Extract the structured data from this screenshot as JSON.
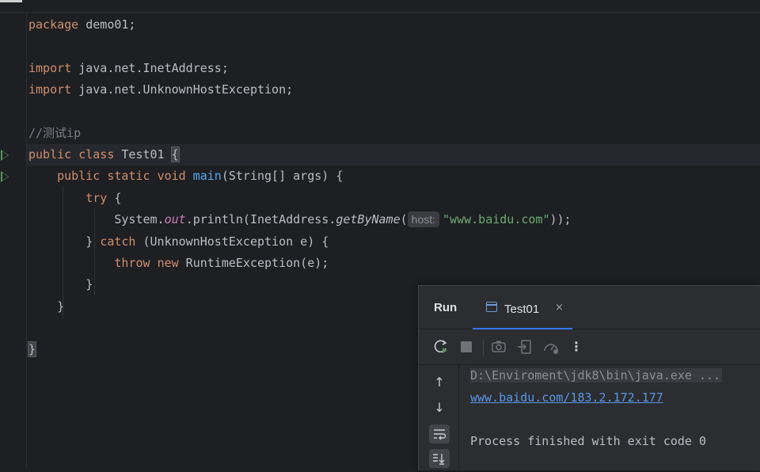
{
  "editor": {
    "package_kw": "package",
    "package_name": " demo01;",
    "import_kw": "import",
    "import1": " java.net.InetAddress;",
    "import2": " java.net.UnknownHostException;",
    "comment": "//测试ip",
    "class_line": {
      "public": "public",
      "class": "class",
      "name": "Test01 ",
      "brace": "{"
    },
    "main_line": {
      "public": "public",
      "static": "static",
      "void": "void",
      "name": "main",
      "rest": "(String[] args) {"
    },
    "try_line": {
      "try": "try",
      "rest": " {"
    },
    "println_line": {
      "pre": "System.",
      "out": "out",
      "mid": ".println(InetAddress.",
      "method": "getByName",
      "open": "(",
      "hint": "host:",
      "str": "\"www.baidu.com\"",
      "close": "));"
    },
    "catch_line": {
      "pre": "} ",
      "catch": "catch",
      "rest": " (UnknownHostException e) {"
    },
    "throw_line": {
      "throw": "throw",
      "new": "new",
      "rest": " RuntimeException(e);"
    },
    "close_inner": "}",
    "close_main": "}",
    "close_class": "}"
  },
  "run_panel": {
    "title": "Run",
    "tab_label": "Test01",
    "tab_close": "×",
    "toolbar": {
      "rerun_icon": "rerun-icon",
      "stop_icon": "stop-icon",
      "screenshot_icon": "camera-icon",
      "exit_icon": "exit-icon",
      "profile_icon": "speedometer-icon",
      "more": "⋮"
    },
    "side": {
      "up": "↑",
      "down": "↓",
      "wrap": "soft-wrap-icon",
      "scroll_end": "scroll-to-end-icon"
    },
    "output": {
      "cmd": "D:\\Enviroment\\jdk8\\bin\\java.exe ...",
      "result": "www.baidu.com/183.2.172.177",
      "finished": "Process finished with exit code 0"
    }
  },
  "colors": {
    "background": "#1e1f22",
    "keyword": "#cf8e6d",
    "function": "#56a8f5",
    "string": "#6aab73",
    "comment": "#7a7e85",
    "accent": "#3574f0"
  }
}
